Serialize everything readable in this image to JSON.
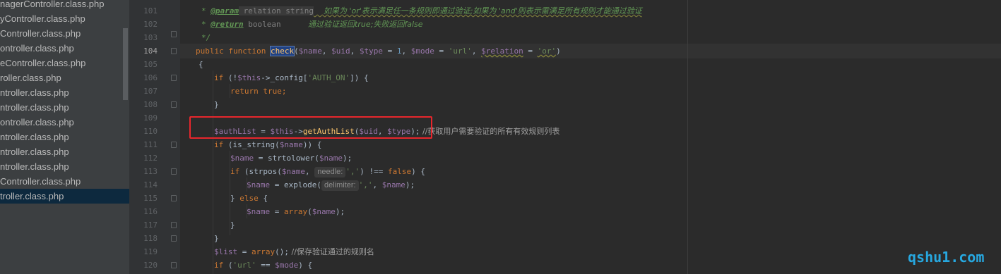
{
  "sidebar": {
    "files": [
      "nagerController.class.php",
      "yController.class.php",
      "Controller.class.php",
      "ontroller.class.php",
      "eController.class.php",
      "roller.class.php",
      "ntroller.class.php",
      "ntroller.class.php",
      "ontroller.class.php",
      "ntroller.class.php",
      "ntroller.class.php",
      "ntroller.class.php",
      "Controller.class.php",
      "troller.class.php"
    ],
    "active_index": 13
  },
  "gutter": {
    "line_numbers": [
      "101",
      "102",
      "103",
      "104",
      "105",
      "106",
      "107",
      "108",
      "109",
      "110",
      "111",
      "112",
      "113",
      "114",
      "115",
      "116",
      "117",
      "118",
      "119",
      "120"
    ],
    "current_line": "104"
  },
  "code": {
    "l101_a": "* ",
    "l101_tag": "@param",
    "l101_b": " relation string",
    "l101_c": "    如果为 'or'表示满足任一条规则即通过验证;如果为 'and'则表示需满足所有规则才能通过验证",
    "l102_a": "* ",
    "l102_tag": "@return",
    "l102_b": " boolean",
    "l102_c": "           通过验证返回true;失败返回false",
    "l103": "*/",
    "l104_kw": "public function ",
    "l104_fn": "check",
    "l104_rest1": "(",
    "l104_p1": "$name",
    "l104_c1": ", ",
    "l104_p2": "$uid",
    "l104_c2": ", ",
    "l104_p3": "$type",
    "l104_eq": " = ",
    "l104_n1": "1",
    "l104_c3": ", ",
    "l104_p4": "$mode",
    "l104_eq2": " = ",
    "l104_s1": "'url'",
    "l104_c4": ", ",
    "l104_p5": "$relation",
    "l104_eq3": " = ",
    "l104_s2": "'or'",
    "l104_end": ")",
    "l105": "{",
    "l106_kw": "if ",
    "l106_a": "(!",
    "l106_this": "$this",
    "l106_b": "->_config[",
    "l106_s": "'AUTH_ON'",
    "l106_c": "]) {",
    "l107_kw": "return true",
    "l107_end": ";",
    "l108": "}",
    "l110_var": "$authList",
    "l110_a": " = ",
    "l110_this": "$this",
    "l110_arrow": "->",
    "l110_fn": "getAuthList",
    "l110_b": "(",
    "l110_p1": "$uid",
    "l110_c": ", ",
    "l110_p2": "$type",
    "l110_d": ");",
    "l110_cmt": " //获取用户需要验证的所有有效规则列表",
    "l111_kw": "if ",
    "l111_a": "(is_string(",
    "l111_v": "$name",
    "l111_b": ")) {",
    "l112_v": "$name",
    "l112_a": " = strtolower(",
    "l112_v2": "$name",
    "l112_b": ");",
    "l113_kw": "if ",
    "l113_a": "(strpos(",
    "l113_v": "$name",
    "l113_b": ", ",
    "l113_hint": "needle:",
    "l113_s": "','",
    "l113_c": ") !== ",
    "l113_kw2": "false",
    "l113_d": ") {",
    "l114_v": "$name",
    "l114_a": " = explode(",
    "l114_hint": "delimiter:",
    "l114_s": "','",
    "l114_b": ", ",
    "l114_v2": "$name",
    "l114_c": ");",
    "l115_a": "} ",
    "l115_kw": "else",
    "l115_b": " {",
    "l116_v": "$name",
    "l116_a": " = ",
    "l116_kw": "array",
    "l116_b": "(",
    "l116_v2": "$name",
    "l116_c": ");",
    "l117": "}",
    "l118": "}",
    "l119_v": "$list",
    "l119_a": " = ",
    "l119_kw": "array",
    "l119_b": "();",
    "l119_cmt": " //保存验证通过的规则名",
    "l120_kw": "if ",
    "l120_a": "(",
    "l120_s": "'url'",
    "l120_b": " == ",
    "l120_v": "$mode",
    "l120_c": ") {"
  },
  "watermark": "qshu1.com",
  "colors": {
    "highlight_box": "#e8262c",
    "watermark": "#27a8e0"
  }
}
